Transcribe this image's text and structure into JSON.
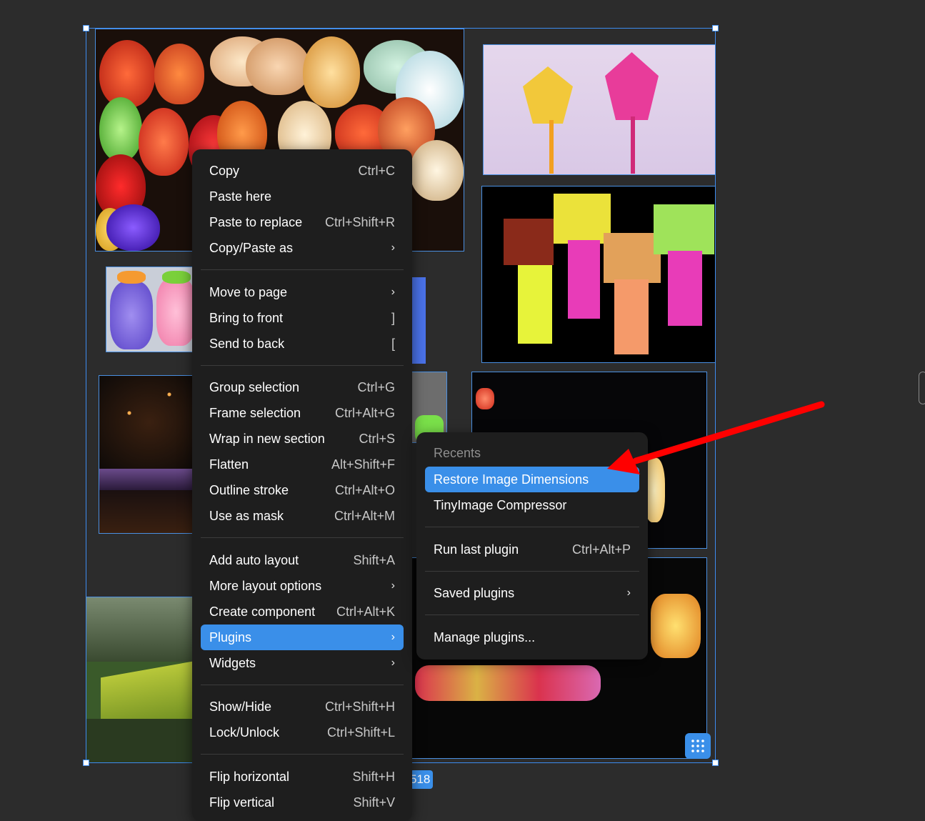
{
  "context_menu": {
    "items": [
      {
        "label": "Copy",
        "shortcut": "Ctrl+C"
      },
      {
        "label": "Paste here",
        "shortcut": ""
      },
      {
        "label": "Paste to replace",
        "shortcut": "Ctrl+Shift+R"
      },
      {
        "label": "Copy/Paste as",
        "shortcut": "›"
      },
      {
        "label": "Move to page",
        "shortcut": "›"
      },
      {
        "label": "Bring to front",
        "shortcut": "]"
      },
      {
        "label": "Send to back",
        "shortcut": "["
      },
      {
        "label": "Group selection",
        "shortcut": "Ctrl+G"
      },
      {
        "label": "Frame selection",
        "shortcut": "Ctrl+Alt+G"
      },
      {
        "label": "Wrap in new section",
        "shortcut": "Ctrl+S"
      },
      {
        "label": "Flatten",
        "shortcut": "Alt+Shift+F"
      },
      {
        "label": "Outline stroke",
        "shortcut": "Ctrl+Alt+O"
      },
      {
        "label": "Use as mask",
        "shortcut": "Ctrl+Alt+M"
      },
      {
        "label": "Add auto layout",
        "shortcut": "Shift+A"
      },
      {
        "label": "More layout options",
        "shortcut": "›"
      },
      {
        "label": "Create component",
        "shortcut": "Ctrl+Alt+K"
      },
      {
        "label": "Plugins",
        "shortcut": "›"
      },
      {
        "label": "Widgets",
        "shortcut": "›"
      },
      {
        "label": "Show/Hide",
        "shortcut": "Ctrl+Shift+H"
      },
      {
        "label": "Lock/Unlock",
        "shortcut": "Ctrl+Shift+L"
      },
      {
        "label": "Flip horizontal",
        "shortcut": "Shift+H"
      },
      {
        "label": "Flip vertical",
        "shortcut": "Shift+V"
      }
    ],
    "active_item": "Plugins"
  },
  "plugins_submenu": {
    "section_label": "Recents",
    "items": [
      {
        "label": "Restore Image Dimensions",
        "shortcut": ""
      },
      {
        "label": "TinyImage Compressor",
        "shortcut": ""
      },
      {
        "label": "Run last plugin",
        "shortcut": "Ctrl+Alt+P"
      },
      {
        "label": "Saved plugins",
        "shortcut": "›"
      },
      {
        "label": "Manage plugins...",
        "shortcut": ""
      }
    ],
    "highlighted_item": "Restore Image Dimensions"
  },
  "canvas": {
    "size_badge": "518",
    "accent_color": "#3a8fe9",
    "arrow_color": "#ff0000"
  }
}
